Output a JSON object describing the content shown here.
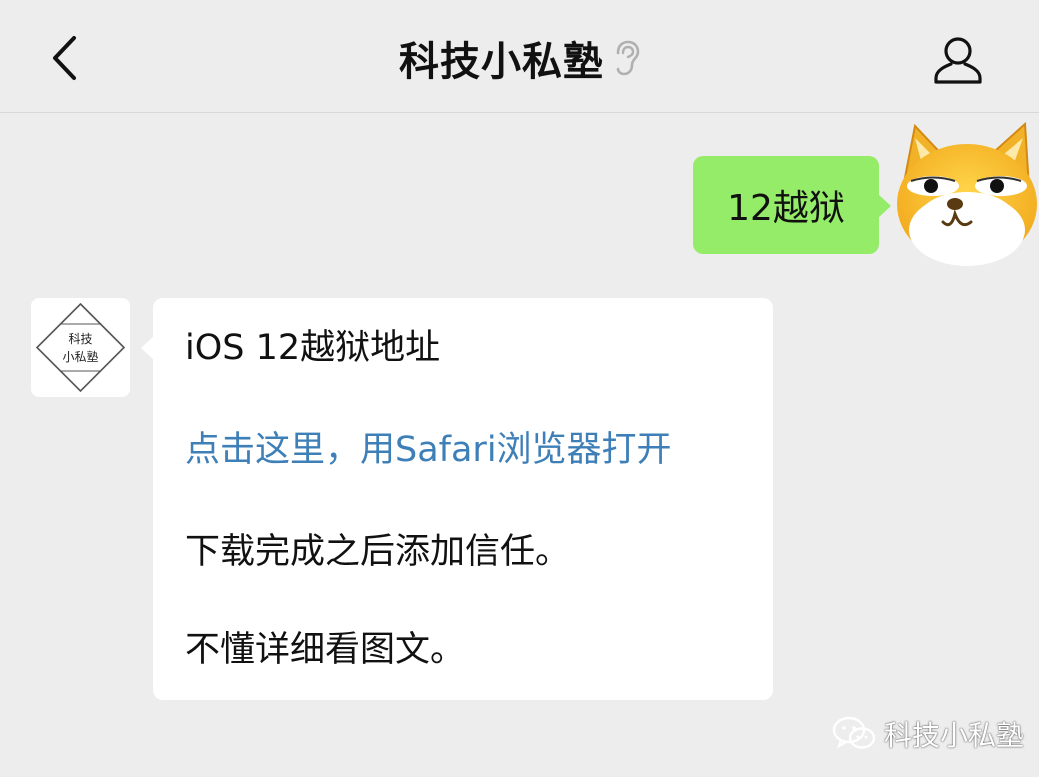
{
  "header": {
    "title": "科技小私塾",
    "back_icon": "chevron-left-icon",
    "mute_icon": "ear-icon",
    "profile_icon": "person-icon"
  },
  "messages": [
    {
      "side": "outgoing",
      "text": "12越狱",
      "bubble_color": "#95ec69"
    },
    {
      "side": "incoming",
      "avatar_text": [
        "科技",
        "小私塾"
      ],
      "lines": [
        "iOS 12越狱地址",
        "点击这里，用Safari浏览器打开",
        "下载完成之后添加信任。",
        "不懂详细看图文。"
      ],
      "link_color": "#3e7fb8"
    }
  ],
  "watermark": {
    "text": "科技小私塾",
    "icon": "wechat-icon"
  },
  "colors": {
    "background": "#ededed",
    "outgoing_bubble": "#95ec69",
    "incoming_bubble": "#ffffff",
    "link": "#3e7fb8"
  }
}
